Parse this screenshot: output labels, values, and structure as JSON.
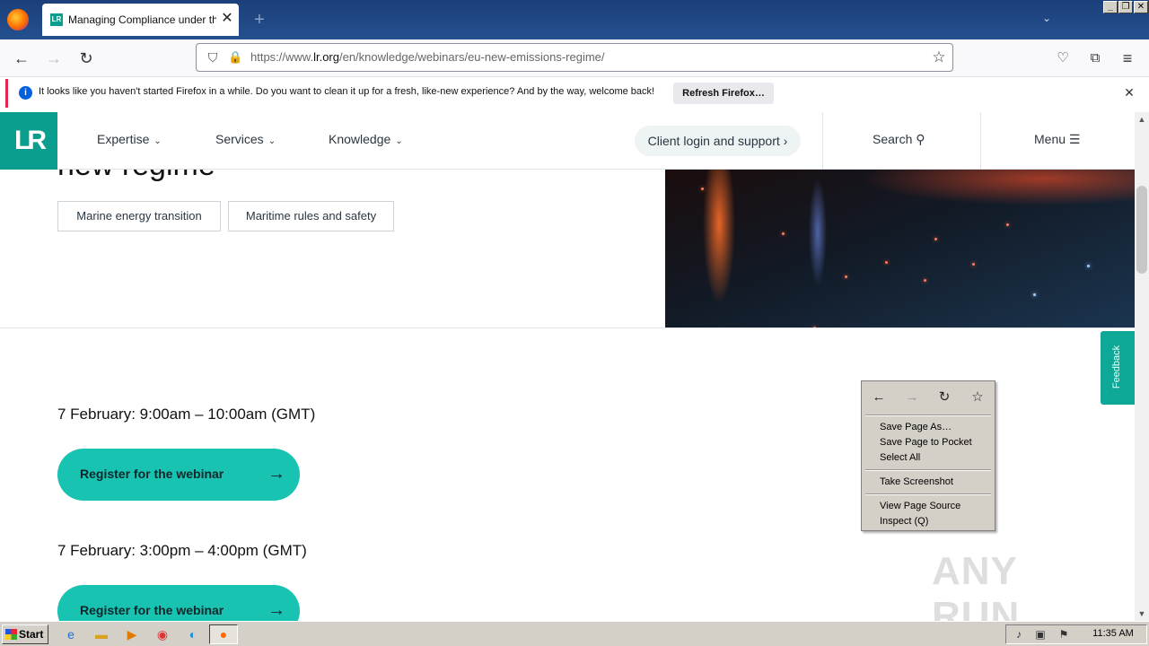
{
  "browser": {
    "tab_title": "Managing Compliance under the EU",
    "tab_favicon": "LR",
    "url_prefix": "https://www.",
    "url_domain": "lr.org",
    "url_path": "/en/knowledge/webinars/eu-new-emissions-regime/",
    "notification_text": "It looks like you haven't started Firefox in a while. Do you want to clean it up for a fresh, like-new experience? And by the way, welcome back!",
    "notification_button": "Refresh Firefox…"
  },
  "site": {
    "logo": "LR",
    "nav": {
      "expertise": "Expertise",
      "services": "Services",
      "knowledge": "Knowledge",
      "client_login": "Client login and support",
      "search": "Search",
      "menu": "Menu"
    },
    "hero_title_fragment": "new regime",
    "tags": [
      "Marine energy transition",
      "Maritime rules and safety"
    ],
    "sessions": [
      {
        "time": "7 February: 9:00am – 10:00am (GMT)",
        "button": "Register for the webinar"
      },
      {
        "time": "7 February: 3:00pm – 4:00pm (GMT)",
        "button": "Register for the webinar"
      }
    ],
    "feedback": "Feedback"
  },
  "context_menu": {
    "items": [
      "Save Page As…",
      "Save Page to Pocket",
      "Select All",
      "Take Screenshot",
      "View Page Source",
      "Inspect (Q)"
    ]
  },
  "watermark": "ANY RUN",
  "taskbar": {
    "start": "Start",
    "clock": "11:35 AM"
  },
  "colors": {
    "brand_teal": "#0a9e8e",
    "button_teal": "#18c3b1"
  }
}
